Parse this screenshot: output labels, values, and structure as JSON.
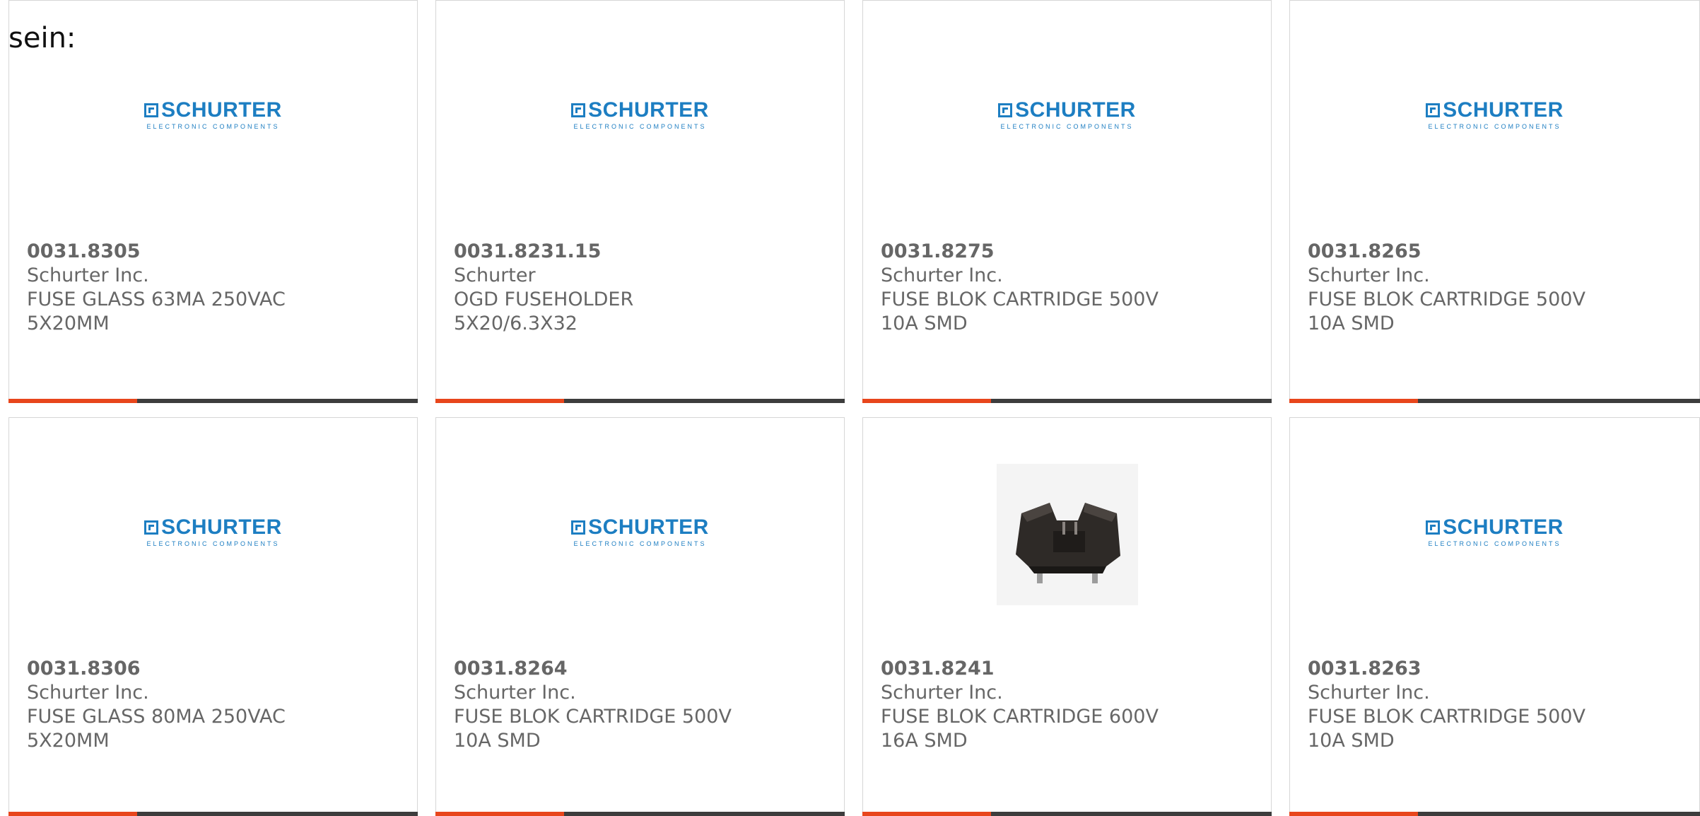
{
  "intro_text": "sein:",
  "colors": {
    "brand_blue": "#1d7ec2",
    "accent_orange": "#e8461c",
    "bar_dark": "#3d3d3d",
    "text_gray": "#666666"
  },
  "logo": {
    "name": "SCHURTER",
    "tagline": "ELECTRONIC COMPONENTS"
  },
  "products": [
    {
      "part": "0031.8305",
      "manufacturer": "Schurter Inc.",
      "description": "FUSE GLASS 63MA 250VAC 5X20MM",
      "image": "schurter-logo"
    },
    {
      "part": "0031.8231.15",
      "manufacturer": "Schurter",
      "description": "OGD FUSEHOLDER 5X20/6.3X32",
      "image": "schurter-logo"
    },
    {
      "part": "0031.8275",
      "manufacturer": "Schurter Inc.",
      "description": "FUSE BLOK CARTRIDGE 500V 10A SMD",
      "image": "schurter-logo"
    },
    {
      "part": "0031.8265",
      "manufacturer": "Schurter Inc.",
      "description": "FUSE BLOK CARTRIDGE 500V 10A SMD",
      "image": "schurter-logo"
    },
    {
      "part": "0031.8306",
      "manufacturer": "Schurter Inc.",
      "description": "FUSE GLASS 80MA 250VAC 5X20MM",
      "image": "schurter-logo"
    },
    {
      "part": "0031.8264",
      "manufacturer": "Schurter Inc.",
      "description": "FUSE BLOK CARTRIDGE 500V 10A SMD",
      "image": "schurter-logo"
    },
    {
      "part": "0031.8241",
      "manufacturer": "Schurter Inc.",
      "description": "FUSE BLOK CARTRIDGE 600V 16A SMD",
      "image": "fuse-holder-photo"
    },
    {
      "part": "0031.8263",
      "manufacturer": "Schurter Inc.",
      "description": "FUSE BLOK CARTRIDGE 500V 10A SMD",
      "image": "schurter-logo"
    }
  ]
}
